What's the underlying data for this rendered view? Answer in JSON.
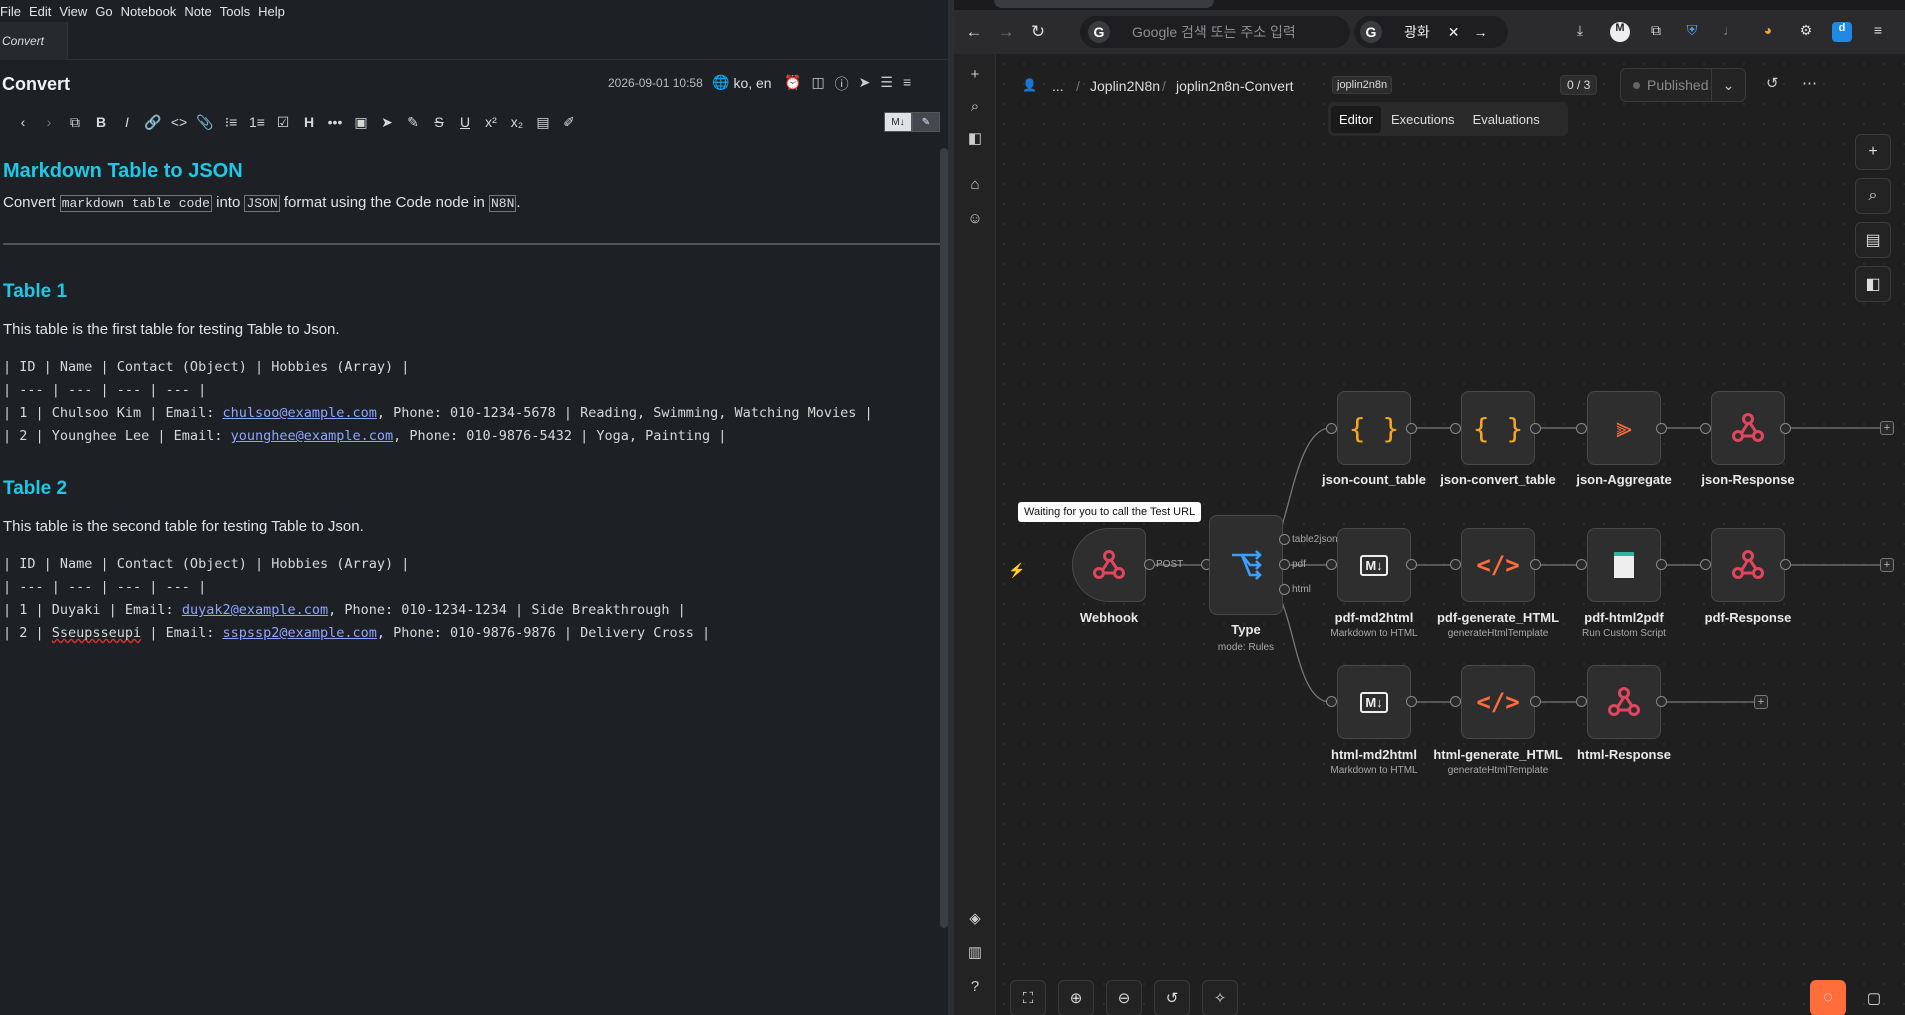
{
  "joplin": {
    "menu": [
      "File",
      "Edit",
      "View",
      "Go",
      "Notebook",
      "Note",
      "Tools",
      "Help"
    ],
    "tab_title": "Convert",
    "note": {
      "title": "Convert",
      "date": "2026-09-01 10:58",
      "language": "ko, en"
    },
    "content": {
      "h1": "Markdown Table to JSON",
      "intro_prefix": "Convert ",
      "intro_code1": "markdown table code",
      "intro_mid1": " into ",
      "intro_code2": "JSON",
      "intro_mid2": " format using the Code node in ",
      "intro_code3": "N8N",
      "intro_suffix": ".",
      "table1_heading": "Table 1",
      "table1_desc": "This table is the first table for testing Table to Json.",
      "table1_header": "| ID | Name | Contact (Object) | Hobbies (Array) |",
      "table1_sep": "| --- | --- | --- | --- |",
      "table1_row1_a": "| 1 | Chulsoo Kim | Email: ",
      "table1_row1_link": "chulsoo@example.com",
      "table1_row1_b": ", Phone: 010-1234-5678 | Reading, Swimming, Watching Movies |",
      "table1_row2_a": "| 2 | Younghee Lee | Email: ",
      "table1_row2_link": "younghee@example.com",
      "table1_row2_b": ", Phone: 010-9876-5432 | Yoga, Painting |",
      "table2_heading": "Table 2",
      "table2_desc": "This table is the second table for testing Table to Json.",
      "table2_header": "| ID | Name | Contact (Object) | Hobbies (Array) |",
      "table2_sep": "| --- | --- | --- | --- |",
      "table2_row1_a": "| 1 | Duyaki | Email: ",
      "table2_row1_link": "duyak2@example.com",
      "table2_row1_b": ", Phone: 010-1234-1234 | Side Breakthrough |",
      "table2_row2_pre": "| 2 | ",
      "table2_row2_name": "Sseupsseupi",
      "table2_row2_mid": " | Email: ",
      "table2_row2_link": "sspssp2@example.com",
      "table2_row2_b": ", Phone: 010-9876-9876 | Delivery Cross |"
    }
  },
  "browser": {
    "url_placeholder": "Google 검색 또는 주소 입력",
    "search_query": "광화"
  },
  "n8n": {
    "breadcrumb": {
      "ellipsis": "...",
      "project": "Joplin2N8n",
      "workflow": "joplin2n8n-Convert",
      "tag": "joplin2n8n"
    },
    "eval_count": "0 / 3",
    "published_label": "Published",
    "tabs": [
      "Editor",
      "Executions",
      "Evaluations"
    ],
    "tooltip": "Waiting for you to call the Test URL",
    "nodes": {
      "webhook": {
        "label": "Webhook"
      },
      "type": {
        "label": "Type",
        "sub": "mode: Rules"
      },
      "json_count": {
        "label": "json-count_table"
      },
      "json_convert": {
        "label": "json-convert_table"
      },
      "json_aggregate": {
        "label": "json-Aggregate"
      },
      "json_response": {
        "label": "json-Response"
      },
      "pdf_md2html": {
        "label": "pdf-md2html",
        "sub": "Markdown to HTML"
      },
      "pdf_generate": {
        "label": "pdf-generate_HTML",
        "sub": "generateHtmlTemplate"
      },
      "pdf_html2pdf": {
        "label": "pdf-html2pdf",
        "sub": "Run Custom Script"
      },
      "pdf_response": {
        "label": "pdf-Response"
      },
      "html_md2html": {
        "label": "html-md2html",
        "sub": "Markdown to HTML"
      },
      "html_generate": {
        "label": "html-generate_HTML",
        "sub": "generateHtmlTemplate"
      },
      "html_response": {
        "label": "html-Response"
      }
    },
    "edge_labels": {
      "post": "POST",
      "table2json": "table2json",
      "pdf": "pdf",
      "html": "html"
    }
  }
}
